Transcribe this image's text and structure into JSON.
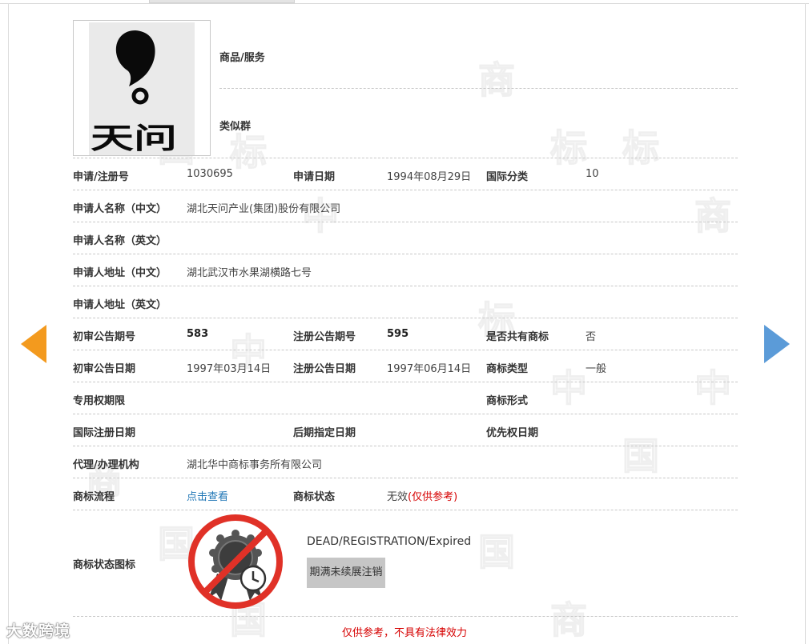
{
  "goods_label": "商品/服务",
  "similar_group_label": "类似群",
  "logo_text": "天问",
  "rows": {
    "reg_no_label": "申请/注册号",
    "reg_no": "1030695",
    "apply_date_label": "申请日期",
    "apply_date": "1994年08月29日",
    "intl_class_label": "国际分类",
    "intl_class": "10",
    "applicant_cn_label": "申请人名称（中文）",
    "applicant_cn": "湖北天问产业(集团)股份有限公司",
    "applicant_en_label": "申请人名称（英文）",
    "address_cn_label": "申请人地址（中文）",
    "address_cn": "湖北武汉市水果湖横路七号",
    "address_en_label": "申请人地址（英文）",
    "prelim_issue_label": "初审公告期号",
    "prelim_issue": "583",
    "reg_issue_label": "注册公告期号",
    "reg_issue": "595",
    "shared_label": "是否共有商标",
    "shared": "否",
    "prelim_date_label": "初审公告日期",
    "prelim_date": "1997年03月14日",
    "reg_date_label": "注册公告日期",
    "reg_date": "1997年06月14日",
    "tm_type_label": "商标类型",
    "tm_type": "一般",
    "exclusive_term_label": "专用权期限",
    "tm_form_label": "商标形式",
    "intl_reg_date_label": "国际注册日期",
    "later_desig_label": "后期指定日期",
    "priority_date_label": "优先权日期",
    "agent_label": "代理/办理机构",
    "agent": "湖北华中商标事务所有限公司",
    "process_label": "商标流程",
    "process_link": "点击查看",
    "status_label": "商标状态",
    "status_value": "无效",
    "status_note": "(仅供参考)",
    "status_icon_label": "商标状态图标",
    "status_en": "DEAD/REGISTRATION/Expired",
    "status_cn_badge": "期满未续展注销"
  },
  "disclaimer": "仅供参考，不具有法律效力",
  "brand": "大数跨境",
  "watermark_chars": [
    "中",
    "国",
    "商",
    "标"
  ],
  "colors": {
    "arrow_left": "#f39a1e",
    "arrow_right": "#5b9bd8",
    "link": "#1f76b6",
    "warning_red": "#d60000",
    "prohibit_red": "#e03127"
  },
  "icons": {
    "prev": "arrow-left-icon",
    "next": "arrow-right-icon",
    "status": "prohibited-certificate-icon"
  }
}
